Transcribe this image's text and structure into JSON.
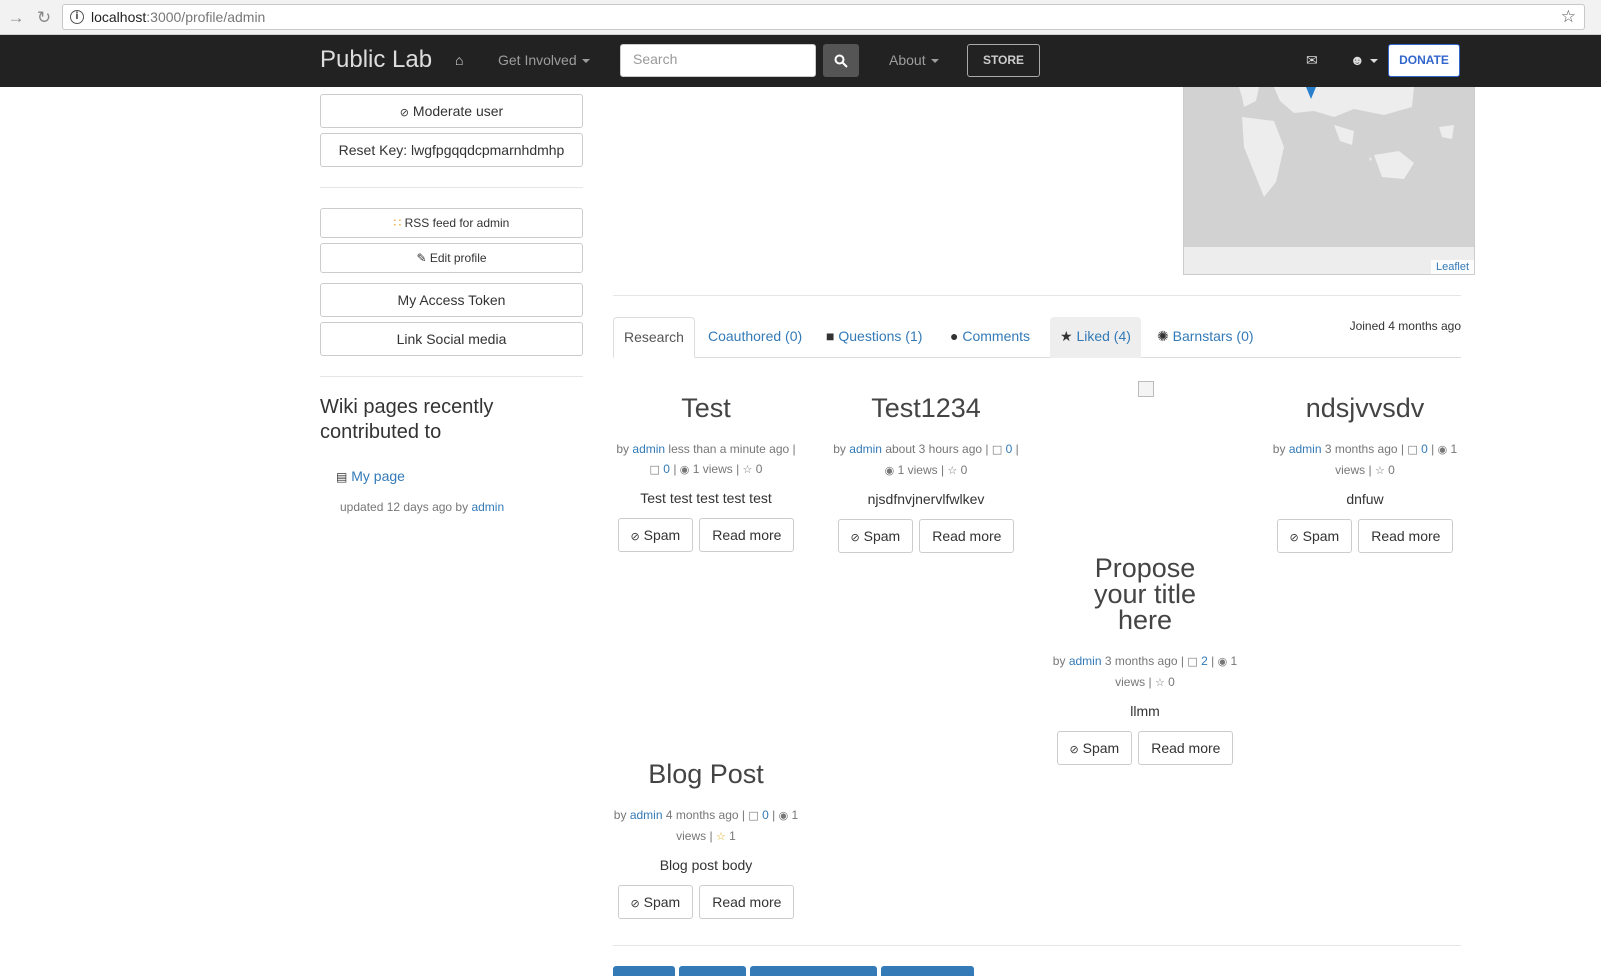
{
  "browser": {
    "url_host": "localhost",
    "url_path": ":3000/profile/admin"
  },
  "navbar": {
    "brand": "Public Lab",
    "get_involved": "Get Involved",
    "search_placeholder": "Search",
    "about": "About",
    "store": "STORE",
    "donate": "DONATE"
  },
  "sidebar": {
    "moderate_user": "Moderate user",
    "reset_key": "Reset Key: lwgfpgqqdcpmarnhdmhp",
    "rss_feed": "RSS feed for admin",
    "edit_profile": "Edit profile",
    "access_token": "My Access Token",
    "link_social": "Link Social media",
    "wiki_heading": "Wiki pages recently contributed to",
    "wiki_items": [
      {
        "title": "My page",
        "updated": "updated 12 days ago by",
        "author": "admin"
      }
    ]
  },
  "map": {
    "credit": "Leaflet"
  },
  "tabs": {
    "research": "Research",
    "coauthored": "Coauthored (0)",
    "questions": "Questions (1)",
    "comments": "Comments",
    "liked": "Liked (4)",
    "barnstars": "Barnstars (0)",
    "joined": "Joined 4 months ago"
  },
  "cards": [
    {
      "title": "Test",
      "by": "by",
      "author": "admin",
      "time": "less than a minute ago",
      "comments": "0",
      "views": "1 views",
      "likes": "0",
      "body": "Test test test test test",
      "spam": "Spam",
      "read_more": "Read more"
    },
    {
      "title": "Test1234",
      "by": "by",
      "author": "admin",
      "time": "about 3 hours ago",
      "comments": "0",
      "views": "1 views",
      "likes": "0",
      "body": "njsdfnvjnervlfwlkev",
      "spam": "Spam",
      "read_more": "Read more"
    },
    {
      "title": "ndsjvvsdv",
      "by": "by",
      "author": "admin",
      "time": "3 months ago",
      "comments": "0",
      "views": "1 views",
      "likes": "0",
      "body": "dnfuw",
      "spam": "Spam",
      "read_more": "Read more"
    },
    {
      "title": "Propose your title here",
      "by": "by",
      "author": "admin",
      "time": "3 months ago",
      "comments": "2",
      "views": "1 views",
      "likes": "0",
      "body": "llmm",
      "spam": "Spam",
      "read_more": "Read more"
    },
    {
      "title": "Blog Post",
      "by": "by",
      "author": "admin",
      "time": "4 months ago",
      "comments": "0",
      "views": "1 views",
      "likes": "1",
      "body": "Blog post body",
      "spam": "Spam",
      "read_more": "Read more"
    }
  ]
}
